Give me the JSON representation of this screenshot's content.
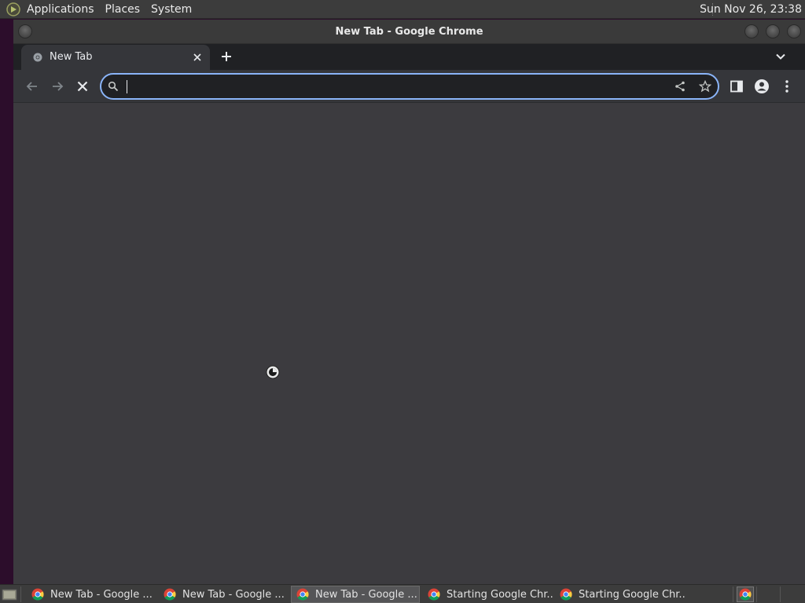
{
  "top_panel": {
    "menus": [
      "Applications",
      "Places",
      "System"
    ],
    "clock": "Sun Nov 26, 23:38"
  },
  "window": {
    "title": "New Tab - Google Chrome"
  },
  "browser": {
    "tab": {
      "label": "New Tab"
    },
    "omnibox": {
      "value": ""
    }
  },
  "taskbar": {
    "items": [
      {
        "label": "New Tab - Google ...",
        "active": false
      },
      {
        "label": "New Tab - Google ...",
        "active": false
      },
      {
        "label": "New Tab - Google ...",
        "active": true
      },
      {
        "label": "Starting Google Chr...",
        "active": false
      },
      {
        "label": "Starting Google Chr...",
        "active": false
      }
    ]
  },
  "colors": {
    "panel": "#3c3c3c",
    "tabstrip": "#202124",
    "toolbar": "#35363a",
    "content": "#3c3b3f",
    "omnibox_focus": "#8ab4f8"
  },
  "icons": [
    "distro-logo-icon",
    "chrome-favicon-icon",
    "close-icon",
    "plus-icon",
    "chevron-down-icon",
    "back-arrow-icon",
    "forward-arrow-icon",
    "stop-icon",
    "search-icon",
    "share-icon",
    "star-icon",
    "side-panel-icon",
    "profile-icon",
    "more-vert-icon",
    "loading-cursor-icon",
    "show-desktop-icon",
    "chrome-icon"
  ]
}
